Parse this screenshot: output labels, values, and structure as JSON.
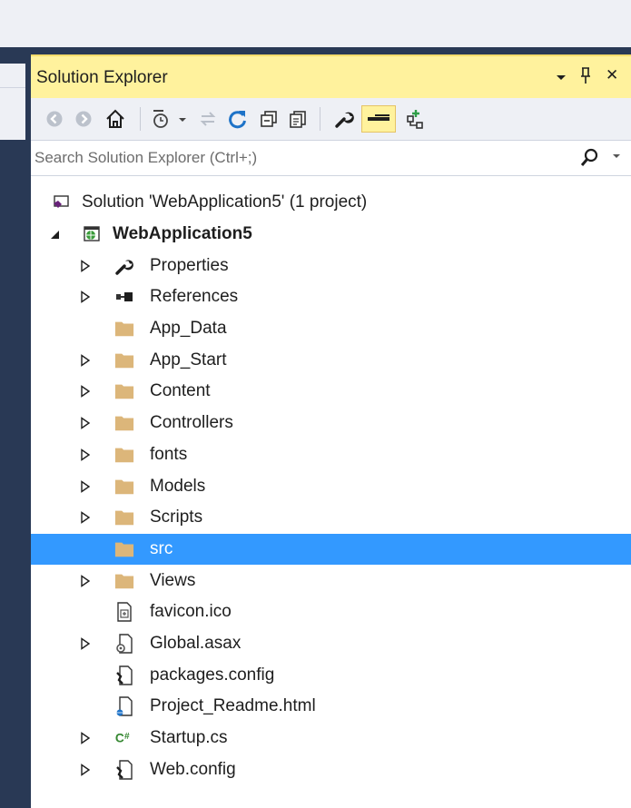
{
  "colors": {
    "frame": "#293955",
    "titlebar_active": "#fff29d",
    "selection": "#3399ff",
    "folder": "#dcb67a",
    "toolbar_bg": "#eef0f5"
  },
  "panel": {
    "title": "Solution Explorer",
    "title_buttons": {
      "dropdown_icon": "caret-down-icon",
      "pin_icon": "pin-icon",
      "close_label": "✕"
    }
  },
  "toolbar": {
    "icons": [
      "back-icon",
      "forward-icon",
      "home-icon",
      "pending-changes-icon",
      "sync-with-active-document-icon",
      "refresh-icon",
      "collapse-all-icon",
      "show-all-files-icon",
      "properties-icon",
      "preview-selected-items-icon",
      "class-view-icon"
    ]
  },
  "search": {
    "placeholder": "Search Solution Explorer (Ctrl+;)"
  },
  "tree": {
    "solution": {
      "label": "Solution 'WebApplication5' (1 project)",
      "icon": "solution-icon"
    },
    "project": {
      "label": "WebApplication5",
      "icon": "web-project-icon",
      "expanded": true
    },
    "items": [
      {
        "label": "Properties",
        "icon": "wrench-icon",
        "expandable": true
      },
      {
        "label": "References",
        "icon": "references-icon",
        "expandable": true
      },
      {
        "label": "App_Data",
        "icon": "folder-icon",
        "expandable": false
      },
      {
        "label": "App_Start",
        "icon": "folder-icon",
        "expandable": true
      },
      {
        "label": "Content",
        "icon": "folder-icon",
        "expandable": true
      },
      {
        "label": "Controllers",
        "icon": "folder-icon",
        "expandable": true
      },
      {
        "label": "fonts",
        "icon": "folder-icon",
        "expandable": true
      },
      {
        "label": "Models",
        "icon": "folder-icon",
        "expandable": true
      },
      {
        "label": "Scripts",
        "icon": "folder-icon",
        "expandable": true
      },
      {
        "label": "src",
        "icon": "folder-icon",
        "expandable": false,
        "selected": true
      },
      {
        "label": "Views",
        "icon": "folder-icon",
        "expandable": true
      },
      {
        "label": "favicon.ico",
        "icon": "image-file-icon",
        "expandable": false
      },
      {
        "label": "Global.asax",
        "icon": "asax-file-icon",
        "expandable": true
      },
      {
        "label": "packages.config",
        "icon": "config-file-icon",
        "expandable": false
      },
      {
        "label": "Project_Readme.html",
        "icon": "html-file-icon",
        "expandable": false
      },
      {
        "label": "Startup.cs",
        "icon": "csharp-file-icon",
        "expandable": true
      },
      {
        "label": "Web.config",
        "icon": "config-file-icon",
        "expandable": true
      }
    ]
  }
}
